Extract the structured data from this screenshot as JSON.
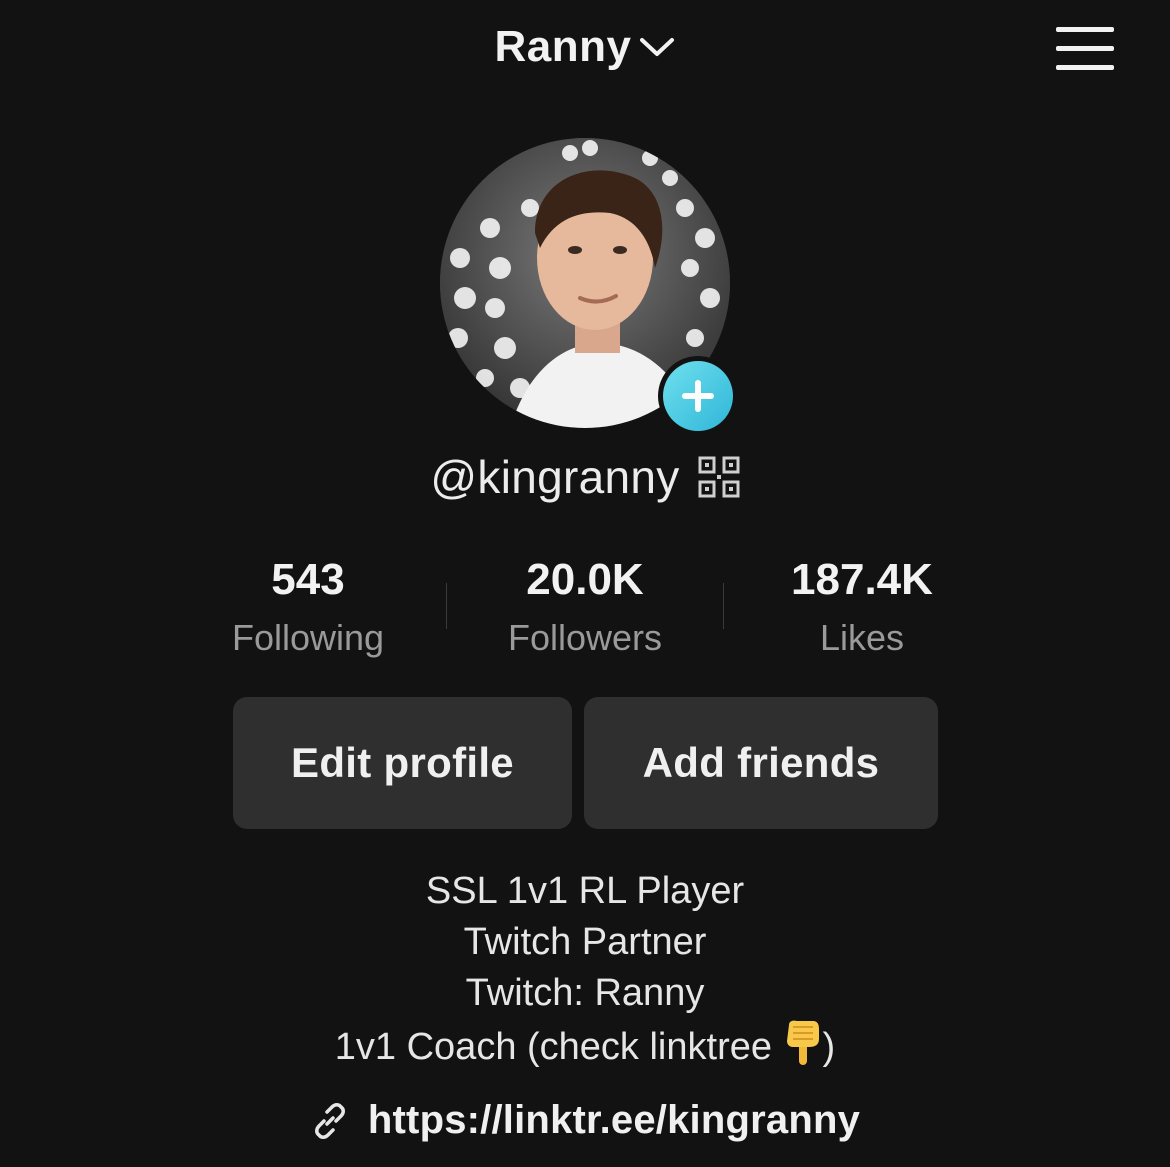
{
  "header": {
    "account_name": "Ranny",
    "dropdown_icon": "chevron-down-icon",
    "menu_icon": "hamburger-menu-icon"
  },
  "profile": {
    "avatar_icon": "profile-photo",
    "add_icon": "plus-icon",
    "username": "@kingranny",
    "qr_icon": "qr-code-icon"
  },
  "stats": [
    {
      "value": "543",
      "label": "Following"
    },
    {
      "value": "20.0K",
      "label": "Followers"
    },
    {
      "value": "187.4K",
      "label": "Likes"
    }
  ],
  "actions": {
    "edit_label": "Edit profile",
    "add_friends_label": "Add friends"
  },
  "bio": {
    "line1": "SSL 1v1 RL Player",
    "line2": "Twitch Partner",
    "line3": "Twitch: Ranny",
    "line4_text": "1v1 Coach (check linktree ",
    "line4_end": ")",
    "emoji_icon": "pointing-down-hand-icon"
  },
  "link": {
    "icon": "link-icon",
    "url": "https://linktr.ee/kingranny"
  },
  "colors": {
    "background": "#121212",
    "button_bg": "#2f2f2f",
    "accent_badge": "#3cc4e0",
    "secondary_text": "#9a9a9a"
  }
}
